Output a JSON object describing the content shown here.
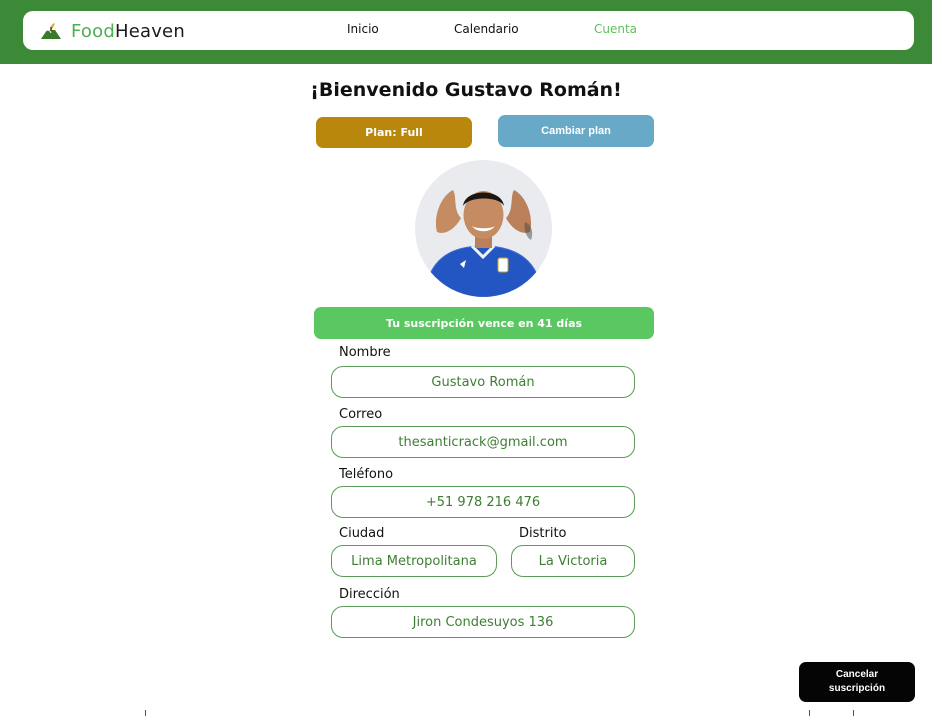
{
  "brand": {
    "name_part1": "Food",
    "name_part2": "Heaven",
    "icon": "bowl-leaf-logo-icon",
    "color_food": "#4caf50",
    "color_heaven": "#1a1a1a"
  },
  "nav": {
    "items": [
      {
        "label": "Inicio",
        "active": false
      },
      {
        "label": "Calendario",
        "active": false
      },
      {
        "label": "Cuenta",
        "active": true
      }
    ]
  },
  "header": {
    "welcome": "¡Bienvenido Gustavo Román!"
  },
  "plan": {
    "label": "Plan: Full",
    "change_label": "Cambiar plan"
  },
  "profile": {
    "avatar": "user-photo-icon"
  },
  "subscription": {
    "message": "Tu suscripción vence en 41 días"
  },
  "form": {
    "nombre": {
      "label": "Nombre",
      "value": "Gustavo Román"
    },
    "correo": {
      "label": "Correo",
      "value": "thesanticrack@gmail.com"
    },
    "telefono": {
      "label": "Teléfono",
      "value": "+51 978 216 476"
    },
    "ciudad": {
      "label": "Ciudad",
      "value": "Lima Metropolitana"
    },
    "distrito": {
      "label": "Distrito",
      "value": "La Victoria"
    },
    "direccion": {
      "label": "Dirección",
      "value": "Jiron Condesuyos 136"
    }
  },
  "actions": {
    "cancel_line1": "Cancelar",
    "cancel_line2": "suscripción"
  },
  "colors": {
    "header_bg": "#3c8a37",
    "accent_green": "#5bc760",
    "plan_gold": "#b8870b",
    "change_blue": "#69a9c8",
    "field_text": "#3e7e34"
  }
}
